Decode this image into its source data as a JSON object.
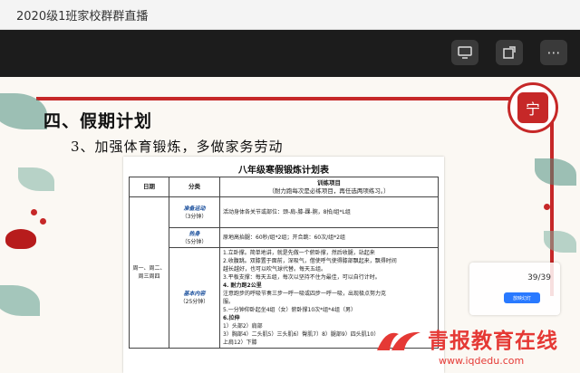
{
  "window": {
    "title": "2020级1班家校群群直播"
  },
  "controls": [
    {
      "icon": "share-screen-icon"
    },
    {
      "icon": "popout-icon"
    },
    {
      "icon": "more-icon"
    }
  ],
  "slide": {
    "heading": "四、假期计划",
    "subheading": "3、加强体育锻炼，多做家务劳动",
    "seal_text": "宁"
  },
  "plan_table": {
    "title": "八年级寒假锻炼计划表",
    "headers": [
      "日期",
      "分类",
      "训练项目"
    ],
    "header_note": "（耐力跑每次是必练项目，再任选两项练习。）",
    "date_label": "周一、周二、周三周四",
    "warmup_label": "准备运动",
    "warmup_time": "（3分钟）",
    "warmup_content": "活动身体各关节或部位：颈-肩-膝-踝-腕，8拍/组*L组",
    "stretch_label": "热身",
    "stretch_time": "（5分钟）",
    "stretch_content": "原地高抬腿：60秒/组*2组；开合跳：60次/组*2组",
    "main_label": "基本内容",
    "main_time": "（25分钟）",
    "main_lines": [
      "1.立卧撑。简单地讲，就是先做一个俯卧撑，然后收腿，站起来",
      "2.收腹跳。双膝置于面前，深吸气，借使呼气使得膝部飘起来，飘得时间",
      "越长越好，也可以吹气球代替。每天五组。",
      "3.平板支撑：每天五组，每次以坚持不住为最佳，可以自行计时。",
      "4. 耐力跑2公里",
      "注意跑步的呼吸节奏三步一呼一吸或四步一呼一吸，出现极点努力克",
      "服。",
      "5.一分钟仰卧起坐4组（女）俯卧撑10次*组*4组（男）",
      "6.拉伸",
      "1）头部2）肩部",
      "3）胸部4）二头肌5）三头肌6）臀肌7）8）腿部9）四头肌10）",
      "上肩12）下膝"
    ]
  },
  "tooltip": {
    "page": "39/39",
    "button": "放映幻灯"
  },
  "watermark": {
    "brand": "青报教育在线",
    "url": "www.iqdedu.com"
  },
  "colors": {
    "accent_red": "#c62828",
    "brand_red": "#e53935",
    "header_blue": "#1a4f9c"
  }
}
